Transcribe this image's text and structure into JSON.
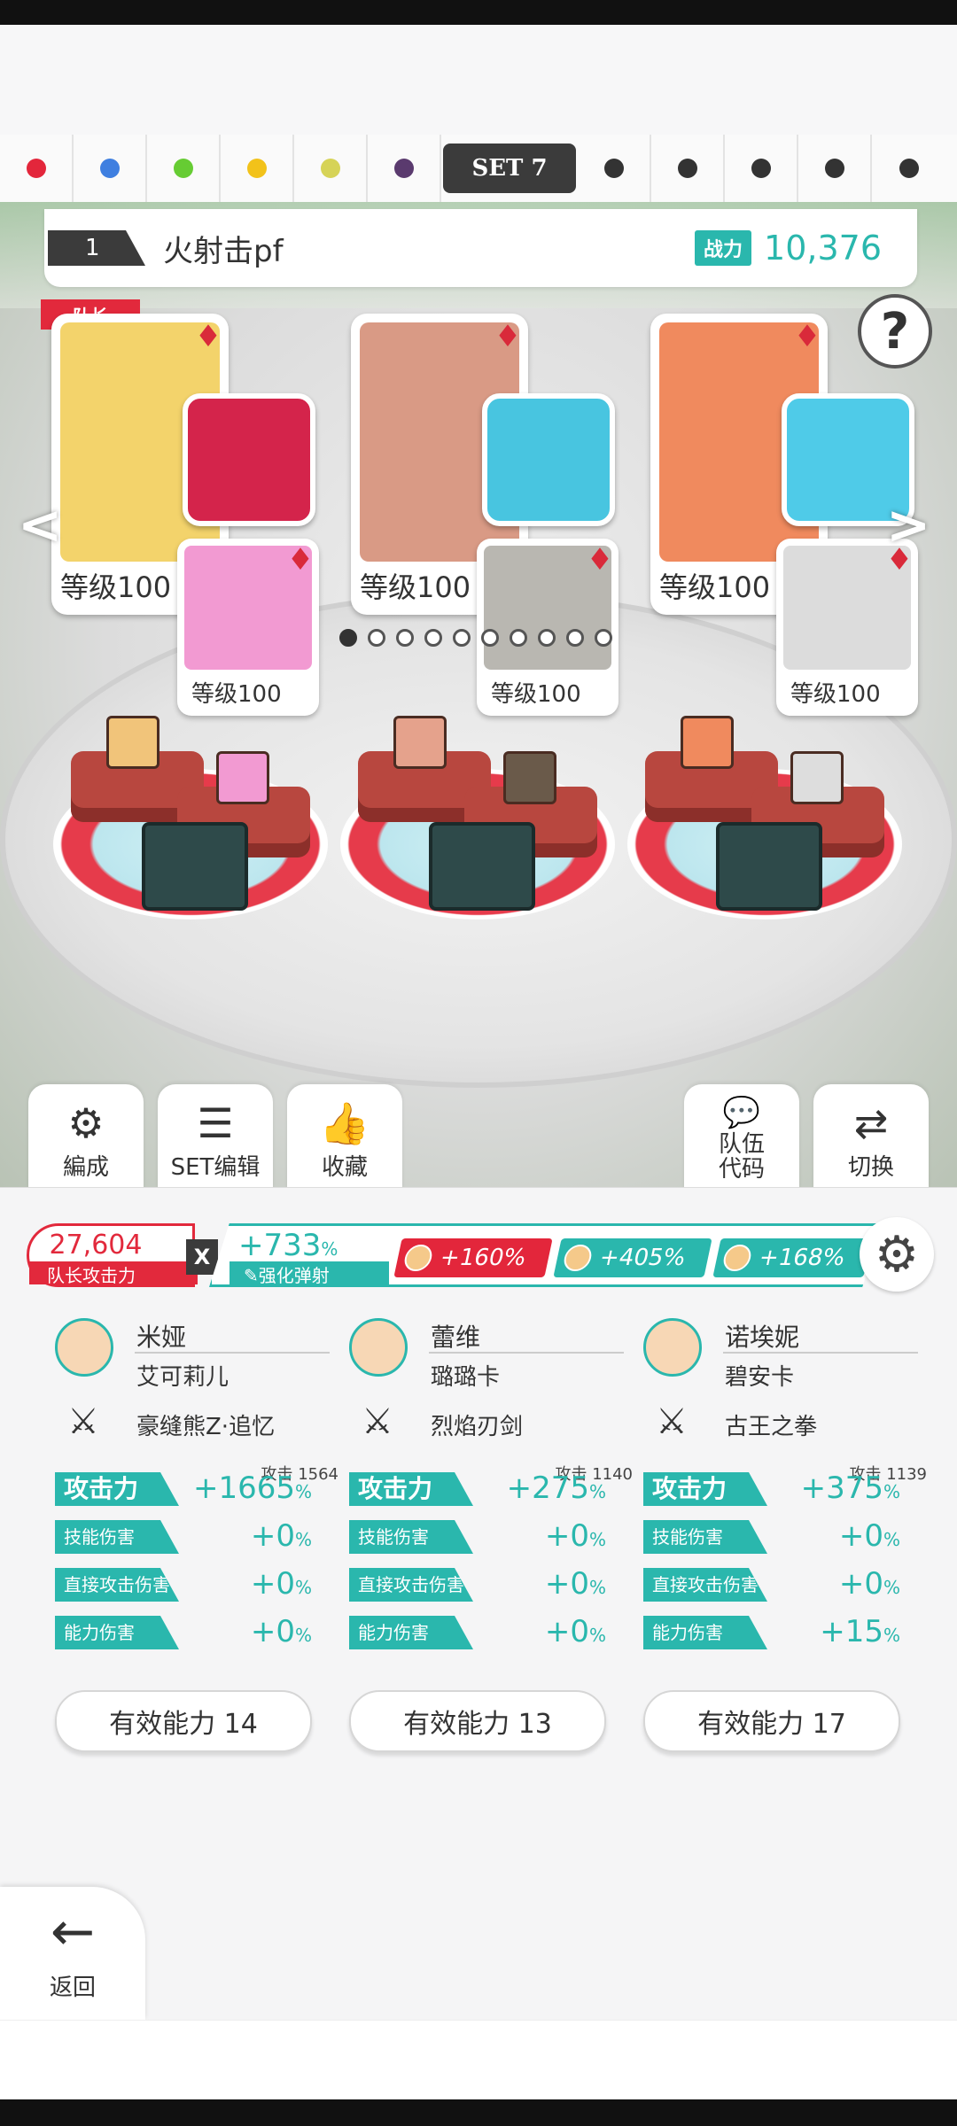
{
  "set_tabs": {
    "dots_left": [
      "#e3263b",
      "#3f7fe0",
      "#66cc33",
      "#f2c21a",
      "#d6d357",
      "#5a3a6e"
    ],
    "active_label": "SET 7",
    "dots_right": [
      "#333333",
      "#333333",
      "#333333",
      "#333333",
      "#333333"
    ]
  },
  "team": {
    "number": "1",
    "name": "火射击pf",
    "power_label": "战力",
    "power_value": "10,376",
    "help_icon": "?"
  },
  "cards": {
    "leader_badge": "队长",
    "main": [
      {
        "level": "等级100",
        "color": "#f3d36b"
      },
      {
        "level": "等级100",
        "color": "#d99a85"
      },
      {
        "level": "等级100",
        "color": "#f08a5e"
      }
    ],
    "sub": [
      {
        "level": "等级100",
        "color": "#f29ad2"
      },
      {
        "level": "等级100",
        "color": "#b9b7b1"
      },
      {
        "level": "等级100",
        "color": "#dcdcdc"
      }
    ],
    "weapons": [
      {
        "icon": "red-gauntlet-icon",
        "color": "#d4244b"
      },
      {
        "icon": "flame-sword-icon",
        "color": "#48c5e0"
      },
      {
        "icon": "black-fist-icon",
        "color": "#4fcbe8"
      }
    ]
  },
  "pager": {
    "count": 10,
    "active": 0
  },
  "actions": {
    "formation": "編成",
    "set_edit": "SET编辑",
    "favorites": "收藏",
    "team_code_line1": "队伍",
    "team_code_line2": "代码",
    "switch": "切换"
  },
  "attack": {
    "leader_value": "27,604",
    "leader_label": "队长攻击力",
    "multiply": "X",
    "buff_value": "+733",
    "buff_unit": "%",
    "buff_label": "强化弹射",
    "chips": [
      {
        "value": "+160%",
        "color": "#e3263b"
      },
      {
        "value": "+405%",
        "color": "#2ab7ad"
      },
      {
        "value": "+168%",
        "color": "#2ab7ad"
      }
    ]
  },
  "members": [
    {
      "name": "米娅",
      "sub": "艾可莉儿",
      "weapon": "豪缝熊Z·追忆",
      "atk_mini": "攻击 1564",
      "stats": [
        {
          "label": "攻击力",
          "value": "+1665"
        },
        {
          "label": "技能伤害",
          "value": "+0"
        },
        {
          "label": "直接攻击伤害",
          "value": "+0"
        },
        {
          "label": "能力伤害",
          "value": "+0"
        }
      ],
      "ability": "有效能力 14"
    },
    {
      "name": "蕾维",
      "sub": "璐璐卡",
      "weapon": "烈焰刃剑",
      "atk_mini": "攻击 1140",
      "stats": [
        {
          "label": "攻击力",
          "value": "+275"
        },
        {
          "label": "技能伤害",
          "value": "+0"
        },
        {
          "label": "直接攻击伤害",
          "value": "+0"
        },
        {
          "label": "能力伤害",
          "value": "+0"
        }
      ],
      "ability": "有效能力 13"
    },
    {
      "name": "诺埃妮",
      "sub": "碧安卡",
      "weapon": "古王之拳",
      "atk_mini": "攻击 1139",
      "stats": [
        {
          "label": "攻击力",
          "value": "+375"
        },
        {
          "label": "技能伤害",
          "value": "+0"
        },
        {
          "label": "直接攻击伤害",
          "value": "+0"
        },
        {
          "label": "能力伤害",
          "value": "+15"
        }
      ],
      "ability": "有效能力 17"
    }
  ],
  "percent": "%",
  "back_label": "返回"
}
